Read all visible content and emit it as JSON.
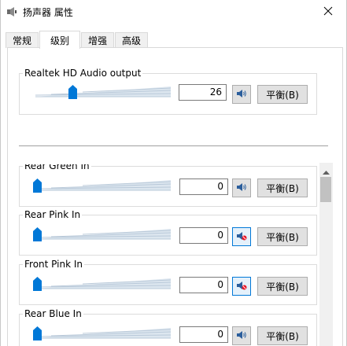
{
  "window": {
    "title": "扬声器 属性",
    "icon": "speaker-icon",
    "close_icon": "close-icon"
  },
  "tabs": [
    {
      "label": "常规",
      "active": false
    },
    {
      "label": "级别",
      "active": true
    },
    {
      "label": "增强",
      "active": false
    },
    {
      "label": "高级",
      "active": false
    }
  ],
  "master": {
    "label": "Realtek HD Audio output",
    "value": "26",
    "level": 0.26,
    "muted": false,
    "balance_label": "平衡(B)"
  },
  "channels": [
    {
      "label": "Rear Green In",
      "value": "0",
      "level": 0,
      "muted": false,
      "balance_label": "平衡(B)"
    },
    {
      "label": "Rear Pink In",
      "value": "0",
      "level": 0,
      "muted": true,
      "balance_label": "平衡(B)"
    },
    {
      "label": "Front Pink In",
      "value": "0",
      "level": 0,
      "muted": true,
      "balance_label": "平衡(B)"
    },
    {
      "label": "Rear Blue In",
      "value": "0",
      "level": 0,
      "muted": false,
      "balance_label": "平衡(B)"
    }
  ],
  "colors": {
    "accent": "#0078d7",
    "slider_thumb": "#0078d7",
    "track": "#b9c9d9"
  }
}
